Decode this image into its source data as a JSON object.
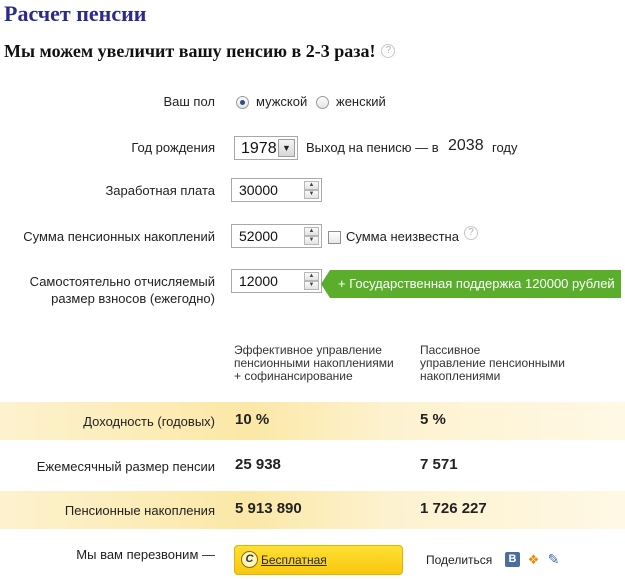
{
  "page": {
    "title": "Расчет пенсии",
    "subtitle": "Мы можем увеличит вашу пенсию в 2-3 раза!",
    "help_glyph": "?"
  },
  "form": {
    "gender": {
      "label": "Ваш пол",
      "options": [
        "мужской",
        "женский"
      ],
      "selected": "мужской"
    },
    "birth_year": {
      "label": "Год рождения",
      "value": "1978",
      "retire_text": "Выход на пенисю — в",
      "retire_year": "2038",
      "retire_suffix": "году"
    },
    "salary": {
      "label": "Заработная плата",
      "value": "30000"
    },
    "savings": {
      "label": "Сумма пенсионных накоплений",
      "value": "52000",
      "unknown_label": "Сумма неизвестна",
      "unknown_checked": false
    },
    "contribution": {
      "label_line1": "Самостоятельно отчисляемый",
      "label_line2": "размер взносов (ежегодно)",
      "value": "12000"
    },
    "state_support": "+ Государственная поддержка 120000 рублей"
  },
  "comparison": {
    "columns": [
      {
        "line1": "Эффективное управление",
        "line2": "пенсионными накоплениями",
        "line3": "+ софинансирование"
      },
      {
        "line1": "Пассивное",
        "line2": "управление пенсионными",
        "line3": "накоплениями"
      }
    ],
    "rows": [
      {
        "label": "Доходность (годовых)",
        "values": [
          "10 %",
          "5 %"
        ]
      },
      {
        "label": "Ежемесячный размер пенсии",
        "values": [
          "25 938",
          "7 571"
        ]
      },
      {
        "label": "Пенсионные накопления",
        "values": [
          "5 913 890",
          "1 726 227"
        ]
      }
    ]
  },
  "footer": {
    "callback_label": "Мы вам перезвоним —",
    "consult_button": "Бесплатная консультация",
    "share_label": "Поделиться",
    "share_icons": [
      "vk-icon",
      "odnoklassniki-icon",
      "bookmark-pen-icon"
    ]
  },
  "colors": {
    "title": "#2b2b8c",
    "accent_green": "#5aae2c",
    "band": "#fbe8a6",
    "button": "#f8c70e"
  }
}
